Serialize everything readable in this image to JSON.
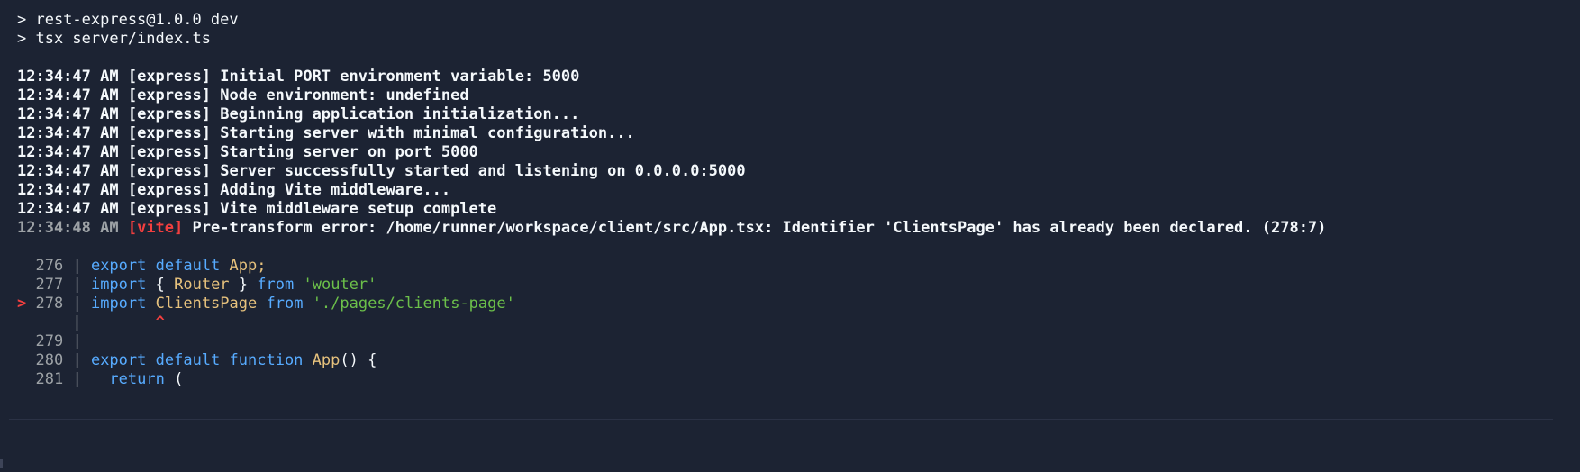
{
  "header": {
    "line1": "> rest-express@1.0.0 dev",
    "line2": "> tsx server/index.ts"
  },
  "logs": [
    {
      "time": "12:34:47 AM",
      "tag": "[express]",
      "msg": "Initial PORT environment variable: 5000"
    },
    {
      "time": "12:34:47 AM",
      "tag": "[express]",
      "msg": "Node environment: undefined"
    },
    {
      "time": "12:34:47 AM",
      "tag": "[express]",
      "msg": "Beginning application initialization..."
    },
    {
      "time": "12:34:47 AM",
      "tag": "[express]",
      "msg": "Starting server with minimal configuration..."
    },
    {
      "time": "12:34:47 AM",
      "tag": "[express]",
      "msg": "Starting server on port 5000"
    },
    {
      "time": "12:34:47 AM",
      "tag": "[express]",
      "msg": "Server successfully started and listening on 0.0.0.0:5000"
    },
    {
      "time": "12:34:47 AM",
      "tag": "[express]",
      "msg": "Adding Vite middleware..."
    },
    {
      "time": "12:34:47 AM",
      "tag": "[express]",
      "msg": "Vite middleware setup complete"
    }
  ],
  "error": {
    "time": "12:34:48 AM",
    "tag": "[vite]",
    "msg": "Pre-transform error: /home/runner/workspace/client/src/App.tsx: Identifier 'ClientsPage' has already been declared. (278:7)"
  },
  "code": {
    "l276": {
      "num": "276",
      "kw1": "export",
      "kw2": "default",
      "id": "App",
      "punct": ";"
    },
    "l277": {
      "num": "277",
      "kw1": "import",
      "open": "{",
      "id": "Router",
      "close": "}",
      "kw2": "from",
      "str": "'wouter'"
    },
    "l278": {
      "marker": ">",
      "num": "278",
      "kw1": "import",
      "id": "ClientsPage",
      "kw2": "from",
      "str": "'./pages/clients-page'"
    },
    "caret": "^",
    "l279": {
      "num": "279"
    },
    "l280": {
      "num": "280",
      "kw1": "export",
      "kw2": "default",
      "kw3": "function",
      "id": "App",
      "rest": "() {"
    },
    "l281": {
      "num": "281",
      "kw1": "return",
      "rest": "("
    }
  },
  "colors": {
    "background": "#1c2333",
    "text": "#f5f9fc",
    "dim": "#9da2a6",
    "error": "#f23f3f",
    "keyword": "#57abff",
    "identifier": "#e7c27d",
    "string": "#6cc04a"
  }
}
